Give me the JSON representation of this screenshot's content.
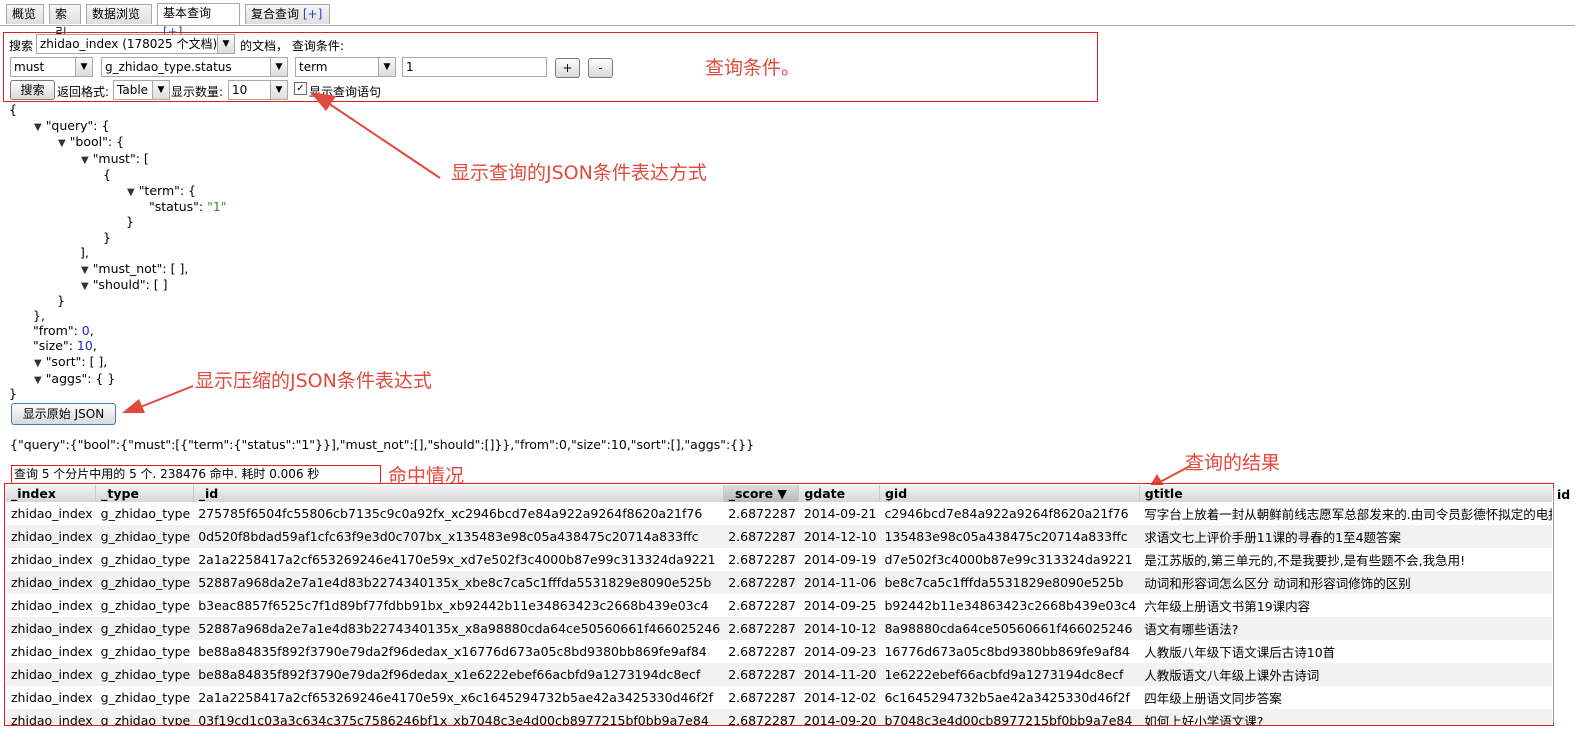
{
  "tabs": [
    {
      "label": "概览",
      "plus": ""
    },
    {
      "label": "索引",
      "plus": ""
    },
    {
      "label": "数据浏览",
      "plus": ""
    },
    {
      "label": "基本查询",
      "plus": "[+]"
    },
    {
      "label": "复合查询",
      "plus": "[+]"
    }
  ],
  "query": {
    "search_label": "搜索",
    "index_select": "zhidao_index (178025 个文档)",
    "doc_label": "的文档，  查询条件:",
    "bool_select": "must",
    "field_select": "g_zhidao_type.status",
    "op_select": "term",
    "value": "1",
    "add_label": "+",
    "remove_label": "-",
    "search_button": "搜索",
    "format_label": "返回格式:",
    "format_select": "Table",
    "count_label": "显示数量:",
    "count_select": "10",
    "show_query_label": "显示查询语句",
    "show_query_checked": true
  },
  "annotations": {
    "conditions": "查询条件。",
    "json_display": "显示查询的JSON条件表达方式",
    "compressed": "显示压缩的JSON条件表达式",
    "hits": "命中情况",
    "results": "查询的结果"
  },
  "json_tree": {
    "l1": "{",
    "query_key": "\"query\": {",
    "bool_key": "\"bool\": {",
    "must_key": "\"must\": [",
    "l5": "{",
    "term_key": "\"term\": {",
    "status_key": "\"status\": ",
    "status_val": "\"1\"",
    "l8": "}",
    "l9": "}",
    "l10": "],",
    "must_not": "\"must_not\": [ ],",
    "should": "\"should\": [ ]",
    "l13": "}",
    "l14": "},",
    "from_key": "\"from\": ",
    "from_val": "0",
    "size_key": "\"size\": ",
    "size_val": "10",
    "comma": ",",
    "sort": "\"sort\": [ ],",
    "aggs": "\"aggs\": { }",
    "l19": "}"
  },
  "raw_json_button": "显示原始 JSON",
  "compressed_json": "{\"query\":{\"bool\":{\"must\":[{\"term\":{\"status\":\"1\"}}],\"must_not\":[],\"should\":[]}},\"from\":0,\"size\":10,\"sort\":[],\"aggs\":{}}",
  "hits_summary": "查询 5 个分片中用的 5 个. 238476 命中. 耗时 0.006 秒",
  "results": {
    "columns": [
      "_index",
      "_type",
      "_id",
      "_score ▼",
      "gdate",
      "gid",
      "gtitle"
    ],
    "extra_col": "id",
    "rows": [
      [
        "zhidao_index",
        "g_zhidao_type",
        "275785f6504fc55806cb7135c9c0a92fx_xc2946bcd7e84a922a9264f8620a21f76",
        "2.6872287",
        "2014-09-21",
        "c2946bcd7e84a922a9264f8620a21f76",
        "写字台上放着一封从朝鲜前线志愿军总部发来的.由司令员彭德怀拟定的电报"
      ],
      [
        "zhidao_index",
        "g_zhidao_type",
        "0d520f8bdad59af1cfc63f9e3d0c707bx_x135483e98c05a438475c20714a833ffc",
        "2.6872287",
        "2014-12-10",
        "135483e98c05a438475c20714a833ffc",
        "求语文七上评价手册11课的寻春的1至4题答案"
      ],
      [
        "zhidao_index",
        "g_zhidao_type",
        "2a1a2258417a2cf653269246e4170e59x_xd7e502f3c4000b87e99c313324da9221",
        "2.6872287",
        "2014-09-19",
        "d7e502f3c4000b87e99c313324da9221",
        "是江苏版的,第三单元的,不是我要抄,是有些题不会,我急用!"
      ],
      [
        "zhidao_index",
        "g_zhidao_type",
        "52887a968da2e7a1e4d83b2274340135x_xbe8c7ca5c1fffda5531829e8090e525b",
        "2.6872287",
        "2014-11-06",
        "be8c7ca5c1fffda5531829e8090e525b",
        "动词和形容词怎么区分 动词和形容词修饰的区别"
      ],
      [
        "zhidao_index",
        "g_zhidao_type",
        "b3eac8857f6525c7f1d89bf77fdbb91bx_xb92442b11e34863423c2668b439e03c4",
        "2.6872287",
        "2014-09-25",
        "b92442b11e34863423c2668b439e03c4",
        "六年级上册语文书第19课内容"
      ],
      [
        "zhidao_index",
        "g_zhidao_type",
        "52887a968da2e7a1e4d83b2274340135x_x8a98880cda64ce50560661f466025246",
        "2.6872287",
        "2014-10-12",
        "8a98880cda64ce50560661f466025246",
        "语文有哪些语法?"
      ],
      [
        "zhidao_index",
        "g_zhidao_type",
        "be88a84835f892f3790e79da2f96dedax_x16776d673a05c8bd9380bb869fe9af84",
        "2.6872287",
        "2014-09-23",
        "16776d673a05c8bd9380bb869fe9af84",
        "人教版八年级下语文课后古诗10首"
      ],
      [
        "zhidao_index",
        "g_zhidao_type",
        "be88a84835f892f3790e79da2f96dedax_x1e6222ebef66acbfd9a1273194dc8ecf",
        "2.6872287",
        "2014-11-20",
        "1e6222ebef66acbfd9a1273194dc8ecf",
        "人教版语文八年级上课外古诗词"
      ],
      [
        "zhidao_index",
        "g_zhidao_type",
        "2a1a2258417a2cf653269246e4170e59x_x6c1645294732b5ae42a3425330d46f2f",
        "2.6872287",
        "2014-12-02",
        "6c1645294732b5ae42a3425330d46f2f",
        "四年级上册语文同步答案"
      ],
      [
        "zhidao_index",
        "g_zhidao_type",
        "03f19cd1c03a3c634c375c7586246bf1x_xb7048c3e4d00cb8977215bf0bb9a7e84",
        "2.6872287",
        "2014-09-20",
        "b7048c3e4d00cb8977215bf0bb9a7e84",
        "如何上好小学语文课?"
      ]
    ]
  },
  "colors": {
    "annotation": "#e04a3c",
    "border_red": "#e02020",
    "number": "#1f24c8",
    "string": "#2e8b2e"
  }
}
